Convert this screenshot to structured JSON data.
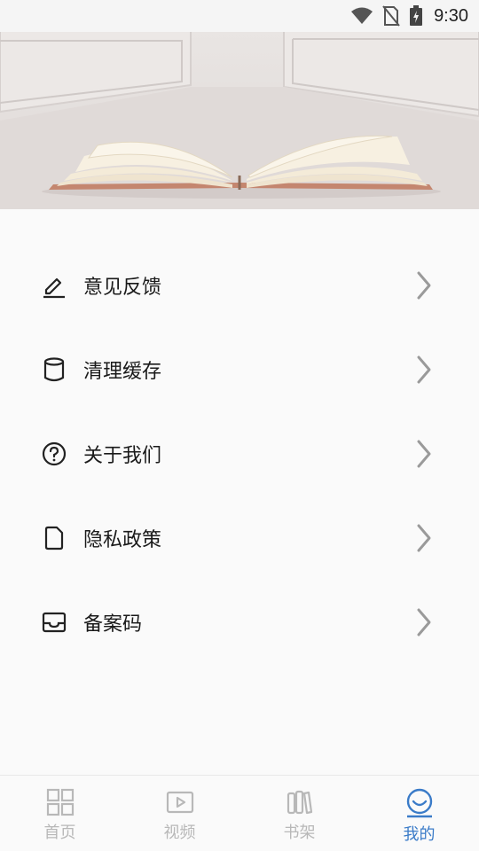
{
  "status_bar": {
    "time": "9:30",
    "icons": [
      "wifi-icon",
      "no-sim-icon",
      "battery-charging-icon"
    ]
  },
  "banner": {
    "image": "open-book-illustration"
  },
  "menu": {
    "items": [
      {
        "label": "意见反馈",
        "icon": "edit-icon"
      },
      {
        "label": "清理缓存",
        "icon": "cylinder-icon"
      },
      {
        "label": "关于我们",
        "icon": "question-circle-icon"
      },
      {
        "label": "隐私政策",
        "icon": "document-icon"
      },
      {
        "label": "备案码",
        "icon": "inbox-icon"
      }
    ]
  },
  "bottom_nav": {
    "items": [
      {
        "label": "首页",
        "icon": "grid-icon",
        "active": false
      },
      {
        "label": "视频",
        "icon": "video-icon",
        "active": false
      },
      {
        "label": "书架",
        "icon": "bookshelf-icon",
        "active": false
      },
      {
        "label": "我的",
        "icon": "smile-icon",
        "active": true
      }
    ],
    "active_color": "#3a7bc8",
    "inactive_color": "#b8b8b8"
  }
}
